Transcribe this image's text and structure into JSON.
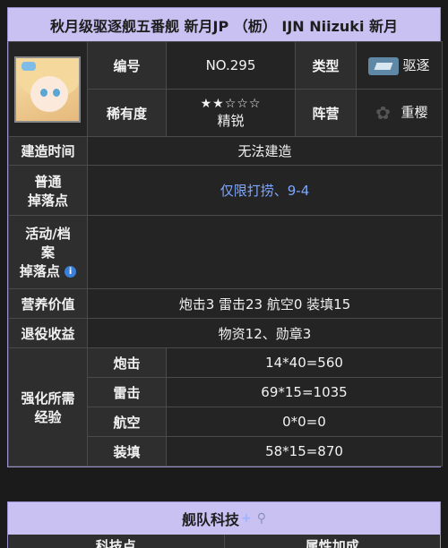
{
  "title": "秋月级驱逐舰五番舰 新月JP （枥） IJN Niizuki 新月",
  "info": {
    "number_label": "编号",
    "number_value": "NO.295",
    "type_label": "类型",
    "type_icon": "destroyer-hull-icon",
    "type_value": "驱逐",
    "rarity_label": "稀有度",
    "rarity_stars": "★★☆☆☆",
    "rarity_value": "精锐",
    "camp_label": "阵营",
    "camp_icon": "sakura-emblem-icon",
    "camp_value": "重樱"
  },
  "rows": {
    "build_label": "建造时间",
    "build_value": "无法建造",
    "drop_label_1": "普通",
    "drop_label_2": "掉落点",
    "drop_value": "仅限打捞、9-4",
    "event_label_1": "活动/档",
    "event_label_2": "案",
    "event_label_3": "掉落点",
    "event_value": "",
    "nutrition_label": "营养价值",
    "nutrition_value": "炮击3 雷击23 航空0 装填15",
    "retire_label": "退役收益",
    "retire_value": "物资12、勋章3",
    "enhance_label_1": "强化所需",
    "enhance_label_2": "经验",
    "enhance": [
      {
        "stat": "炮击",
        "value": "14*40=560"
      },
      {
        "stat": "雷击",
        "value": "69*15=1035"
      },
      {
        "stat": "航空",
        "value": "0*0=0"
      },
      {
        "stat": "装填",
        "value": "58*15=870"
      }
    ]
  },
  "fleet_tech": {
    "title": "舰队科技",
    "col1": "科技点",
    "col2": "属性加成"
  },
  "colors": {
    "title_bg": "#c9c1f2",
    "link": "#7da7ff",
    "info_dot": "#3a7fd8"
  }
}
